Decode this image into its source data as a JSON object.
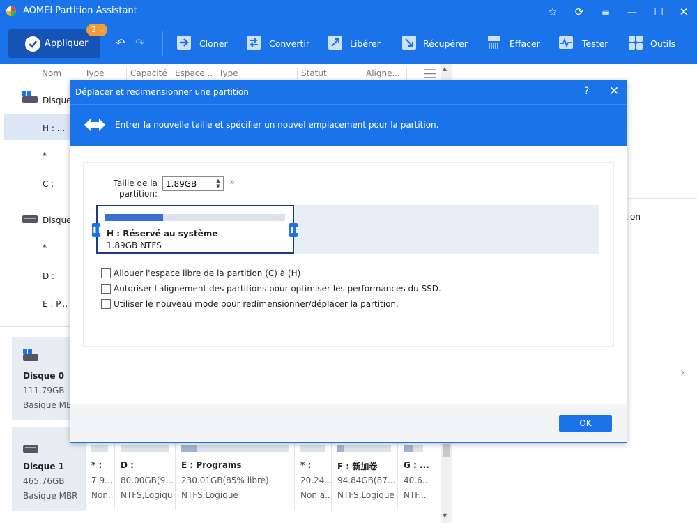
{
  "window": {
    "title": "AOMEI Partition Assistant"
  },
  "toolbar": {
    "apply_label": "Appliquer",
    "pending_count": "2",
    "tools": [
      {
        "label": "Cloner",
        "icon": "clone-icon"
      },
      {
        "label": "Convertir",
        "icon": "convert-icon"
      },
      {
        "label": "Libérer",
        "icon": "free-icon"
      },
      {
        "label": "Récupérer",
        "icon": "recover-icon"
      },
      {
        "label": "Effacer",
        "icon": "wipe-icon"
      },
      {
        "label": "Tester",
        "icon": "test-icon"
      },
      {
        "label": "Outils",
        "icon": "tools-icon"
      }
    ]
  },
  "table": {
    "columns": [
      "Nom",
      "Type",
      "Capacité",
      "Espace...",
      "Type",
      "Statut",
      "Aligne..."
    ]
  },
  "tree": {
    "disk1_label": "Disque",
    "disk1_parts": [
      "H : ...",
      "*",
      "C :"
    ],
    "disk2_label": "Disque",
    "disk2_parts": [
      "*",
      "D :",
      "E : P..."
    ]
  },
  "right_panel": {
    "partial_text": "tion"
  },
  "disks": [
    {
      "name": "Disque 0",
      "size": "111.79GB",
      "type": "Basique MBR"
    },
    {
      "name": "Disque 1",
      "size": "465.76GB",
      "type": "Basique MBR"
    }
  ],
  "disk1_partitions": [
    {
      "name": "* :",
      "size": "7.9...",
      "type": "Non...",
      "fill": 0
    },
    {
      "name": "D :",
      "size": "80.00GB(9...",
      "type": "NTFS,Logiqu",
      "fill": 0
    },
    {
      "name": "E : Programs",
      "size": "230.01GB(85% libre)",
      "type": "NTFS,Logique",
      "fill": 0.15
    },
    {
      "name": "* :",
      "size": "20.24...",
      "type": "Non a...",
      "fill": 0
    },
    {
      "name": "F : 新加卷",
      "size": "94.84GB(87...",
      "type": "NTFS,Logique",
      "fill": 0.13
    },
    {
      "name": "G : ...",
      "size": "40.6...",
      "type": "NTF...",
      "fill": 0.5
    }
  ],
  "dialog": {
    "title": "Déplacer et redimensionner une partition",
    "help": "?",
    "close": "✕",
    "header_text": "Entrer la nouvelle taille et spécifier un nouvel emplacement pour la partition.",
    "size_label": "Taille de la partition:",
    "size_value": "1.89GB",
    "partition": {
      "name": "H : Réservé au système",
      "size": "1.89GB NTFS",
      "used_fraction": 0.32
    },
    "options": [
      {
        "label": "Allouer l'espace libre de la partition (C) à (H)",
        "checked": false
      },
      {
        "label": "Autoriser l'alignement des partitions pour optimiser les performances du SSD.",
        "checked": false
      },
      {
        "label": "Utiliser le nouveau mode pour redimensionner/déplacer la partition.",
        "checked": false
      }
    ],
    "ok_label": "OK"
  },
  "colors": {
    "accent": "#1a73e8",
    "apply_bg": "#1553b5",
    "badge": "#f39c3c",
    "partition_border": "#1a3c8a"
  }
}
